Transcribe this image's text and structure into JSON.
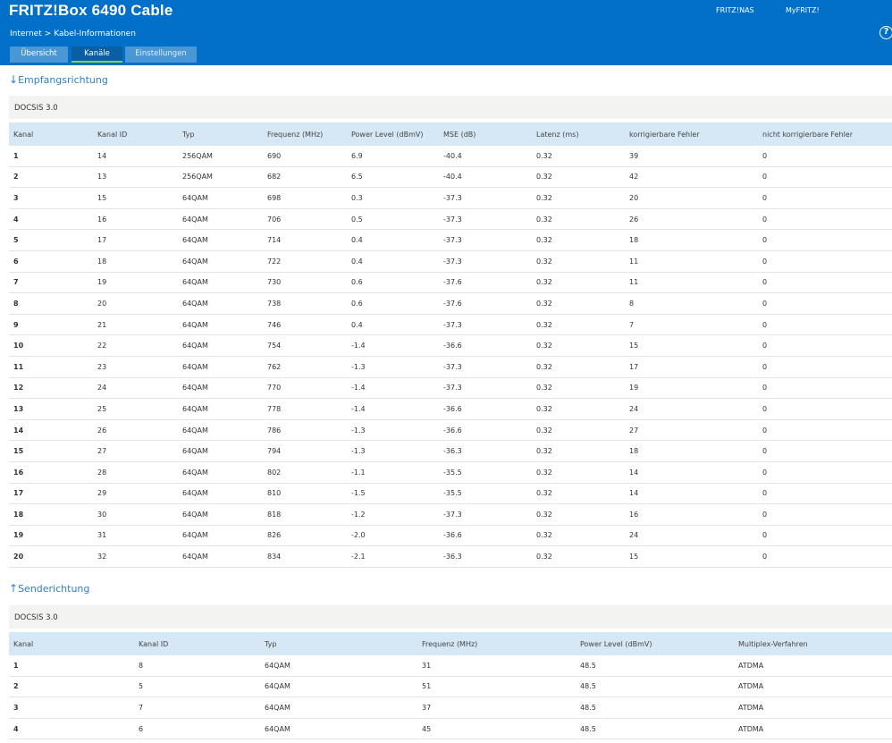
{
  "header": {
    "title": "FRITZ!Box 6490 Cable",
    "links": [
      "FRITZ!NAS",
      "MyFRITZ!"
    ]
  },
  "breadcrumb": {
    "section": "Internet",
    "page": "Kabel-Informationen"
  },
  "help_label": "?",
  "tabs": [
    {
      "label": "Übersicht"
    },
    {
      "label": "Kanäle"
    },
    {
      "label": "Einstellungen"
    }
  ],
  "downstream": {
    "title": "Empfangsrichtung",
    "arrow": "↓",
    "docsis": "DOCSIS 3.0",
    "columns": [
      "Kanal",
      "Kanal ID",
      "Typ",
      "Frequenz (MHz)",
      "Power Level (dBmV)",
      "MSE (dB)",
      "Latenz (ms)",
      "korrigierbare Fehler",
      "nicht korrigierbare Fehler"
    ],
    "rows": [
      [
        "1",
        "14",
        "256QAM",
        "690",
        "6.9",
        "-40.4",
        "0.32",
        "39",
        "0"
      ],
      [
        "2",
        "13",
        "256QAM",
        "682",
        "6.5",
        "-40.4",
        "0.32",
        "42",
        "0"
      ],
      [
        "3",
        "15",
        "64QAM",
        "698",
        "0.3",
        "-37.3",
        "0.32",
        "20",
        "0"
      ],
      [
        "4",
        "16",
        "64QAM",
        "706",
        "0.5",
        "-37.3",
        "0.32",
        "26",
        "0"
      ],
      [
        "5",
        "17",
        "64QAM",
        "714",
        "0.4",
        "-37.3",
        "0.32",
        "18",
        "0"
      ],
      [
        "6",
        "18",
        "64QAM",
        "722",
        "0.4",
        "-37.3",
        "0.32",
        "11",
        "0"
      ],
      [
        "7",
        "19",
        "64QAM",
        "730",
        "0.6",
        "-37.6",
        "0.32",
        "11",
        "0"
      ],
      [
        "8",
        "20",
        "64QAM",
        "738",
        "0.6",
        "-37.6",
        "0.32",
        "8",
        "0"
      ],
      [
        "9",
        "21",
        "64QAM",
        "746",
        "0.4",
        "-37.3",
        "0.32",
        "7",
        "0"
      ],
      [
        "10",
        "22",
        "64QAM",
        "754",
        "-1.4",
        "-36.6",
        "0.32",
        "15",
        "0"
      ],
      [
        "11",
        "23",
        "64QAM",
        "762",
        "-1.3",
        "-37.3",
        "0.32",
        "17",
        "0"
      ],
      [
        "12",
        "24",
        "64QAM",
        "770",
        "-1.4",
        "-37.3",
        "0.32",
        "19",
        "0"
      ],
      [
        "13",
        "25",
        "64QAM",
        "778",
        "-1.4",
        "-36.6",
        "0.32",
        "24",
        "0"
      ],
      [
        "14",
        "26",
        "64QAM",
        "786",
        "-1.3",
        "-36.6",
        "0.32",
        "27",
        "0"
      ],
      [
        "15",
        "27",
        "64QAM",
        "794",
        "-1.3",
        "-36.3",
        "0.32",
        "18",
        "0"
      ],
      [
        "16",
        "28",
        "64QAM",
        "802",
        "-1.1",
        "-35.5",
        "0.32",
        "14",
        "0"
      ],
      [
        "17",
        "29",
        "64QAM",
        "810",
        "-1.5",
        "-35.5",
        "0.32",
        "14",
        "0"
      ],
      [
        "18",
        "30",
        "64QAM",
        "818",
        "-1.2",
        "-37.3",
        "0.32",
        "16",
        "0"
      ],
      [
        "19",
        "31",
        "64QAM",
        "826",
        "-2.0",
        "-36.6",
        "0.32",
        "24",
        "0"
      ],
      [
        "20",
        "32",
        "64QAM",
        "834",
        "-2.1",
        "-36.3",
        "0.32",
        "15",
        "0"
      ]
    ]
  },
  "upstream": {
    "title": "Senderichtung",
    "arrow": "↑",
    "docsis": "DOCSIS 3.0",
    "columns": [
      "Kanal",
      "Kanal ID",
      "Typ",
      "Frequenz (MHz)",
      "Power Level (dBmV)",
      "Multiplex-Verfahren"
    ],
    "rows": [
      [
        "1",
        "8",
        "64QAM",
        "31",
        "48.5",
        "ATDMA"
      ],
      [
        "2",
        "5",
        "64QAM",
        "51",
        "48.5",
        "ATDMA"
      ],
      [
        "3",
        "7",
        "64QAM",
        "37",
        "48.5",
        "ATDMA"
      ],
      [
        "4",
        "6",
        "64QAM",
        "45",
        "48.5",
        "ATDMA"
      ]
    ]
  },
  "colors": {
    "brand_blue": "#0270c9",
    "link_blue": "#2d7fc9",
    "table_header": "#d6e8f5",
    "active_tab_underline": "#7ed34f"
  }
}
